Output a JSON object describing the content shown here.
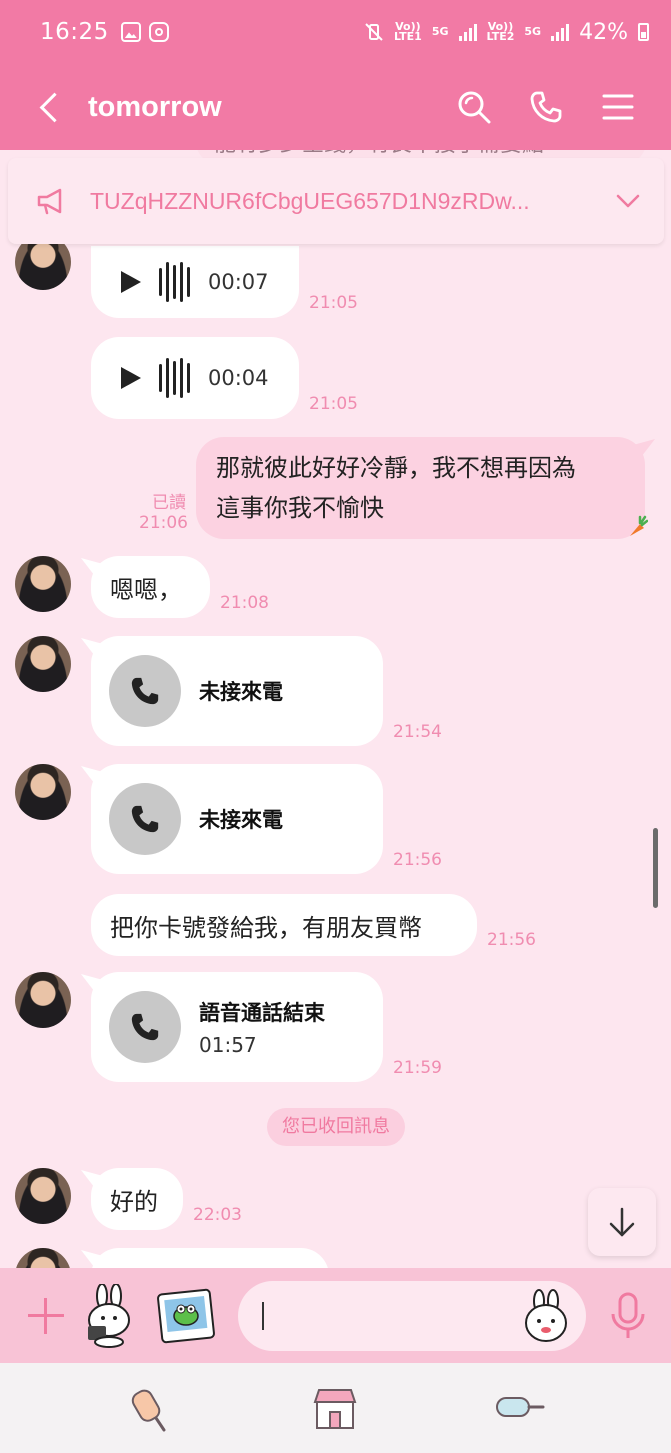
{
  "status_bar": {
    "time": "16:25",
    "net1_top": "Vo))",
    "net1_bottom": "LTE1",
    "net1_tag": "5G",
    "net2_top": "Vo))",
    "net2_bottom": "LTE2",
    "net2_tag": "5G",
    "battery": "42%"
  },
  "header": {
    "title": "tomorrow",
    "icons": [
      "back-icon",
      "search-icon",
      "phone-icon",
      "menu-icon"
    ]
  },
  "chat": {
    "peek_text": "能有多少金錢，有良單接了需要點",
    "announcement": "TUZqHZZNUR6fCbgUEG657D1N9zRDw...",
    "messages": [
      {
        "type": "voice",
        "duration": "00:07",
        "time": "21:05"
      },
      {
        "type": "voice",
        "duration": "00:04",
        "time": "21:05"
      },
      {
        "type": "outgoing",
        "line1": "那就彼此好好冷靜，我不想再因為",
        "line2": "這事你我不愉快",
        "read": "已讀",
        "time": "21:06"
      },
      {
        "type": "text",
        "text": "嗯嗯，",
        "time": "21:08"
      },
      {
        "type": "call",
        "title": "未接來電",
        "time": "21:54"
      },
      {
        "type": "call",
        "title": "未接來電",
        "time": "21:56"
      },
      {
        "type": "text",
        "text": "把你卡號發給我，有朋友買幣",
        "time": "21:56"
      },
      {
        "type": "call",
        "title": "語音通話結束",
        "duration": "01:57",
        "time": "21:59"
      },
      {
        "type": "system",
        "text": "您已收回訊息"
      },
      {
        "type": "text",
        "text": "好的",
        "time": "22:03"
      }
    ]
  },
  "colors": {
    "header_bg": "#f27aa5",
    "chat_bg": "#fde6ef",
    "outgoing_bubble": "#fcd2e1",
    "timestamp": "#f08cb0",
    "accent": "#f07aa0"
  }
}
